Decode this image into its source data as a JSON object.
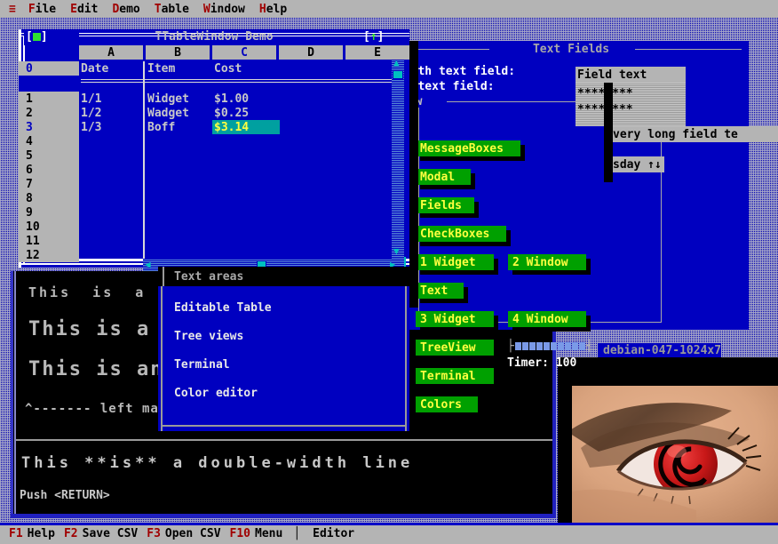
{
  "menubar": {
    "hamburger": "≡",
    "items": [
      {
        "hotkey": "F",
        "rest": "ile"
      },
      {
        "hotkey": "E",
        "rest": "dit"
      },
      {
        "hotkey": "D",
        "rest": "emo"
      },
      {
        "hotkey": "T",
        "rest": "able"
      },
      {
        "hotkey": "W",
        "rest": "indow"
      },
      {
        "hotkey": "H",
        "rest": "elp"
      }
    ]
  },
  "statusbar": {
    "keys": [
      {
        "key": "F1",
        "label": "Help"
      },
      {
        "key": "F2",
        "label": "Save CSV"
      },
      {
        "key": "F3",
        "label": "Open CSV"
      },
      {
        "key": "F10",
        "label": "Menu"
      }
    ],
    "separator": "│",
    "mode": "Editor"
  },
  "table_window": {
    "title": "TTableWindow Demo",
    "close_button": "[■]",
    "zoom_button": "[↑]",
    "column_headers": [
      "A",
      "B",
      "C",
      "D",
      "E"
    ],
    "selected_column": "C",
    "row_headers": [
      "0",
      "1",
      "2",
      "3",
      "4",
      "5",
      "6",
      "7",
      "8",
      "9",
      "10",
      "11",
      "12"
    ],
    "selected_row": "3",
    "header_row": [
      "Date",
      "Item",
      "Cost"
    ],
    "rows": [
      {
        "row": "1",
        "date": "1/1",
        "item": "Widget",
        "cost": "$1.00"
      },
      {
        "row": "2",
        "date": "1/2",
        "item": "Wadget",
        "cost": "$0.25"
      },
      {
        "row": "3",
        "date": "1/3",
        "item": "Boff",
        "cost": "$3.14"
      }
    ],
    "selected_cell_value": "$3.14",
    "scroll_left_arrow": "◀",
    "scroll_right_arrow": "▶",
    "scroll_up_arrow": "▲",
    "scroll_down_arrow": "▼"
  },
  "text_areas_window": {
    "title": "Text areas",
    "items": [
      "Editable Table",
      "Tree views",
      "Terminal",
      "Color editor"
    ]
  },
  "fields_window": {
    "title": "Text Fields",
    "labels": {
      "fixed_width": "width text field:",
      "full_width": "th text field:",
      "group": "dow"
    },
    "field_text": "Field text",
    "password_lines": [
      "********",
      "********"
    ],
    "long_field": "very long field te",
    "day_field": "sday ↑↓",
    "buttons": [
      {
        "label": "MessageBoxes",
        "hot": "M"
      },
      {
        "label": "Modal",
        "hot": "M"
      },
      {
        "label": "Fields",
        "hot": "s"
      },
      {
        "label": "CheckBoxes",
        "hot": "C"
      },
      {
        "label": "1 Widget",
        "hot": "1"
      },
      {
        "label": "2 Window",
        "hot": "2"
      },
      {
        "label": "Text",
        "hot": "T"
      },
      {
        "label": "3 Widget",
        "hot": "3"
      },
      {
        "label": "4 Window",
        "hot": "4"
      },
      {
        "label": "TreeView",
        "hot": "V"
      },
      {
        "label": "Terminal",
        "hot": "n"
      },
      {
        "label": "Colors",
        "hot": "l"
      }
    ],
    "slider": {
      "left_cap": "├",
      "right_cap": "┤",
      "blocks": 10
    },
    "timer_label": "Timer: 100"
  },
  "big_text_window": {
    "lines": [
      "This  is  a",
      "This is a",
      "This is an",
      "^------- left margi"
    ],
    "double_width_line": "This **is** a double-width line",
    "prompt": "Push <RETURN>"
  },
  "image_window": {
    "title": "debian-047-1024x7"
  },
  "colors": {
    "desktop_blue": "#0000b0",
    "window_blue": "#0000c0",
    "menubar_grey": "#b4b4b4",
    "hotkey_red": "#a00000",
    "button_green": "#00a000",
    "button_text_yellow": "#ffff40",
    "highlight_cyan": "#00a0a0",
    "black": "#000000"
  }
}
